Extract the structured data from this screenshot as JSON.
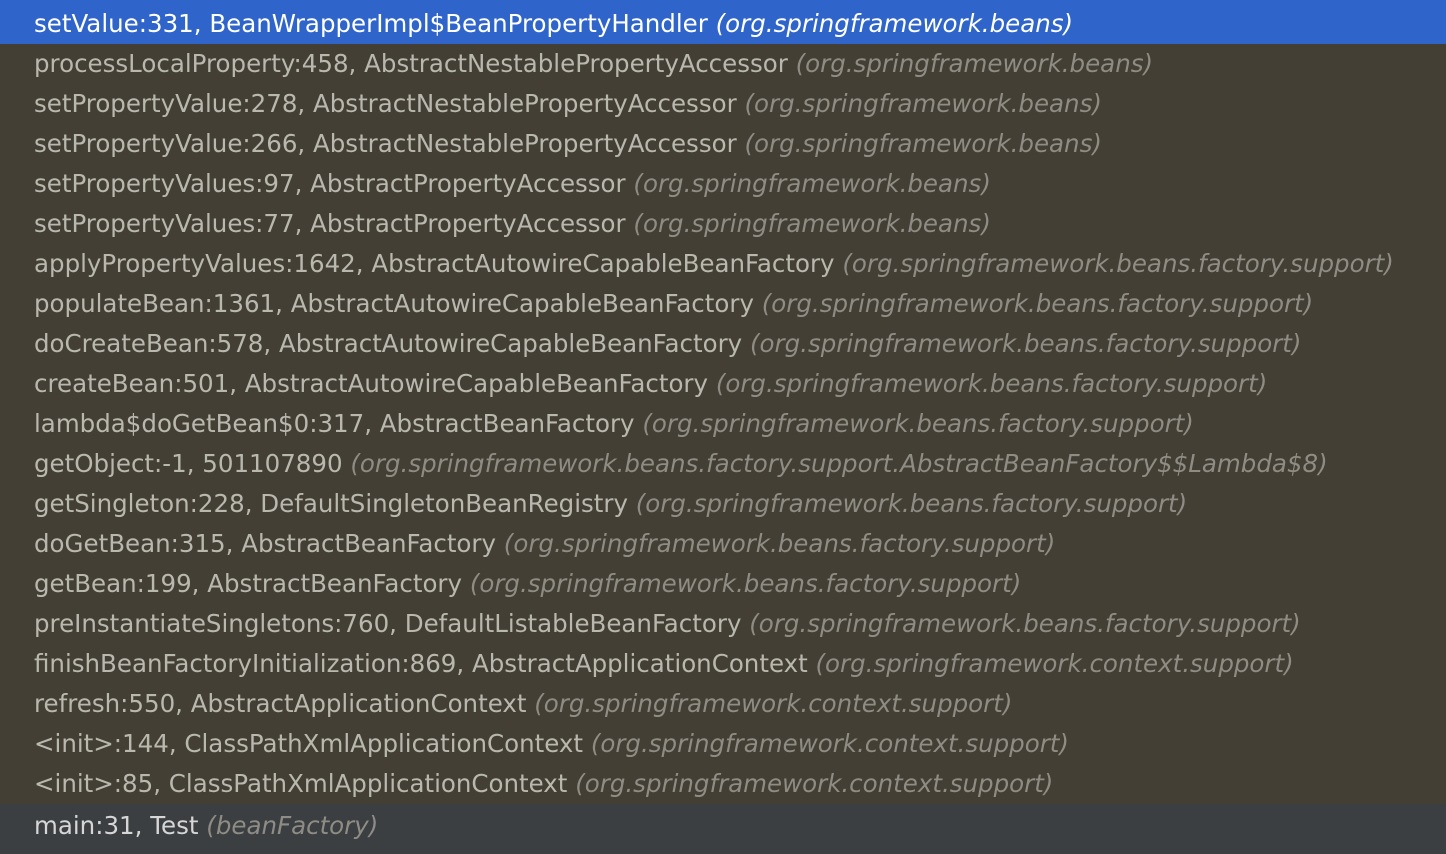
{
  "frames_panel": {
    "selected_index": 0,
    "frames": [
      {
        "location": "setValue:331, BeanWrapperImpl$BeanPropertyHandler",
        "package": "(org.springframework.beans)",
        "kind": "selected"
      },
      {
        "location": "processLocalProperty:458, AbstractNestablePropertyAccessor",
        "package": "(org.springframework.beans)",
        "kind": "library"
      },
      {
        "location": "setPropertyValue:278, AbstractNestablePropertyAccessor",
        "package": "(org.springframework.beans)",
        "kind": "library"
      },
      {
        "location": "setPropertyValue:266, AbstractNestablePropertyAccessor",
        "package": "(org.springframework.beans)",
        "kind": "library"
      },
      {
        "location": "setPropertyValues:97, AbstractPropertyAccessor",
        "package": "(org.springframework.beans)",
        "kind": "library"
      },
      {
        "location": "setPropertyValues:77, AbstractPropertyAccessor",
        "package": "(org.springframework.beans)",
        "kind": "library"
      },
      {
        "location": "applyPropertyValues:1642, AbstractAutowireCapableBeanFactory",
        "package": "(org.springframework.beans.factory.support)",
        "kind": "library"
      },
      {
        "location": "populateBean:1361, AbstractAutowireCapableBeanFactory",
        "package": "(org.springframework.beans.factory.support)",
        "kind": "library"
      },
      {
        "location": "doCreateBean:578, AbstractAutowireCapableBeanFactory",
        "package": "(org.springframework.beans.factory.support)",
        "kind": "library"
      },
      {
        "location": "createBean:501, AbstractAutowireCapableBeanFactory",
        "package": "(org.springframework.beans.factory.support)",
        "kind": "library"
      },
      {
        "location": "lambda$doGetBean$0:317, AbstractBeanFactory",
        "package": "(org.springframework.beans.factory.support)",
        "kind": "library"
      },
      {
        "location": "getObject:-1, 501107890",
        "package": "(org.springframework.beans.factory.support.AbstractBeanFactory$$Lambda$8)",
        "kind": "library"
      },
      {
        "location": "getSingleton:228, DefaultSingletonBeanRegistry",
        "package": "(org.springframework.beans.factory.support)",
        "kind": "library"
      },
      {
        "location": "doGetBean:315, AbstractBeanFactory",
        "package": "(org.springframework.beans.factory.support)",
        "kind": "library"
      },
      {
        "location": "getBean:199, AbstractBeanFactory",
        "package": "(org.springframework.beans.factory.support)",
        "kind": "library"
      },
      {
        "location": "preInstantiateSingletons:760, DefaultListableBeanFactory",
        "package": "(org.springframework.beans.factory.support)",
        "kind": "library"
      },
      {
        "location": "finishBeanFactoryInitialization:869, AbstractApplicationContext",
        "package": "(org.springframework.context.support)",
        "kind": "library"
      },
      {
        "location": "refresh:550, AbstractApplicationContext",
        "package": "(org.springframework.context.support)",
        "kind": "library"
      },
      {
        "location": "<init>:144, ClassPathXmlApplicationContext",
        "package": "(org.springframework.context.support)",
        "kind": "library"
      },
      {
        "location": "<init>:85, ClassPathXmlApplicationContext",
        "package": "(org.springframework.context.support)",
        "kind": "library"
      },
      {
        "location": "main:31, Test",
        "package": "(beanFactory)",
        "kind": "user"
      }
    ]
  },
  "colors": {
    "background": "#433f34",
    "selection": "#2f65ca",
    "user_frame_background": "#3b3f42",
    "location_text": "#b9b8af",
    "package_text": "#8e8c84"
  }
}
